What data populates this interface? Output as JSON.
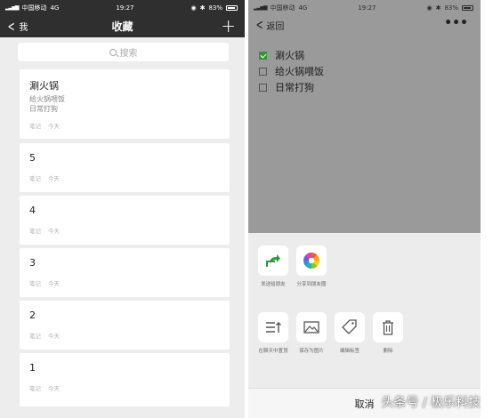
{
  "left_screen": {
    "status": {
      "carrier": "中国移动",
      "network": "4G",
      "time": "19:27",
      "battery": "83%"
    },
    "nav": {
      "back_label": "我",
      "title": "收藏",
      "add_icon": "plus-icon"
    },
    "search": {
      "placeholder": "搜索"
    },
    "cards": [
      {
        "title": "涮火锅",
        "subtitles": [
          "给火锅喂饭",
          "日常打狗"
        ],
        "type": "笔记",
        "date": "今天"
      },
      {
        "title": "5",
        "subtitles": [],
        "type": "笔记",
        "date": "今天"
      },
      {
        "title": "4",
        "subtitles": [],
        "type": "笔记",
        "date": "今天"
      },
      {
        "title": "3",
        "subtitles": [],
        "type": "笔记",
        "date": "今天"
      },
      {
        "title": "2",
        "subtitles": [],
        "type": "笔记",
        "date": "今天"
      },
      {
        "title": "1",
        "subtitles": [],
        "type": "笔记",
        "date": "今天"
      }
    ]
  },
  "right_screen": {
    "status": {
      "carrier": "中国移动",
      "network": "4G",
      "time": "19:27",
      "battery": "83%"
    },
    "nav": {
      "back_label": "返回",
      "more_icon": "more-icon"
    },
    "todos": [
      {
        "label": "涮火锅",
        "checked": true
      },
      {
        "label": "给火锅喂饭",
        "checked": false
      },
      {
        "label": "日常打狗",
        "checked": false
      }
    ],
    "share_actions": [
      {
        "label": "发送给朋友",
        "icon": "share-forward-icon"
      },
      {
        "label": "分享到朋友圈",
        "icon": "moments-icon"
      }
    ],
    "tool_actions": [
      {
        "label": "在聊天中置顶",
        "icon": "pin-top-icon"
      },
      {
        "label": "保存为图片",
        "icon": "image-icon"
      },
      {
        "label": "编辑标签",
        "icon": "tag-icon"
      },
      {
        "label": "删除",
        "icon": "trash-icon"
      }
    ],
    "cancel_label": "取消"
  },
  "watermark": "头条号 / 极乐科技",
  "colors": {
    "header_dark": "#2f2f2f",
    "list_bg": "#ededed",
    "overlay_gray": "#9a9a9a",
    "sheet_bg": "#ececec",
    "check_green": "#3a8f3a",
    "share_green": "#2a9a3a"
  }
}
